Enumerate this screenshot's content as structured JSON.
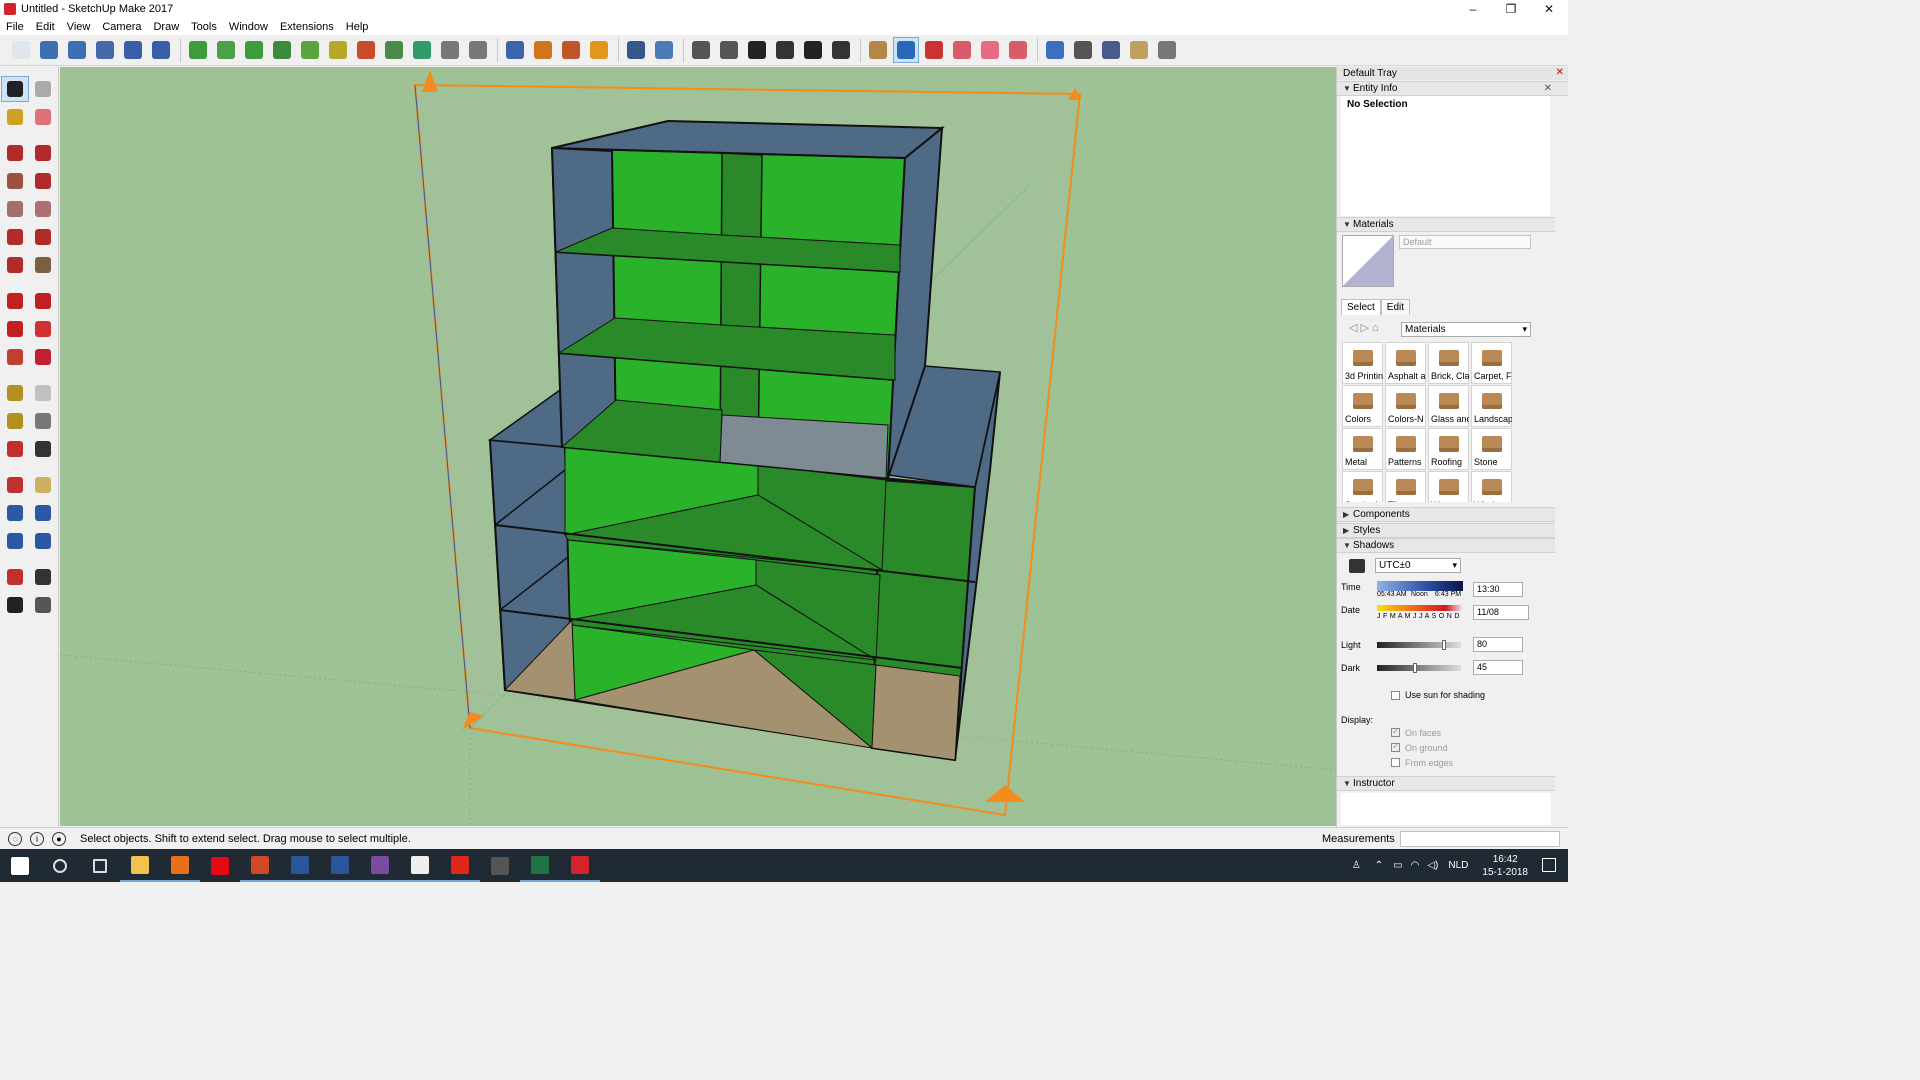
{
  "window": {
    "title": "Untitled - SketchUp Make 2017",
    "minimize": "–",
    "maximize": "❐",
    "close": "✕"
  },
  "menu": [
    "File",
    "Edit",
    "View",
    "Camera",
    "Draw",
    "Tools",
    "Window",
    "Extensions",
    "Help"
  ],
  "toolbar_icons": [
    "new-file-icon",
    "open-icon",
    "save-icon",
    "model-info-icon",
    "export-ifc-icon",
    "import-ifc-icon",
    "sep",
    "add-location-icon",
    "add-3d-text-icon",
    "photo-textures-icon",
    "preview-google-earth-icon",
    "get-models-icon",
    "add-light-icon",
    "sandbox-icon",
    "smoove-icon",
    "stamp-icon",
    "drape-icon",
    "flip-edge-icon",
    "sep",
    "zoom-icon",
    "filter-icon",
    "paint-tag-icon",
    "warning-icon",
    "sep",
    "cube-icon",
    "help-icon",
    "sep",
    "iso-view-icon",
    "top-view-icon",
    "front-view-icon",
    "right-view-icon",
    "back-view-icon",
    "left-view-icon",
    "sep",
    "xray-icon",
    "back-edges-icon",
    "wireframe-icon",
    "hidden-line-icon",
    "shaded-icon",
    "shaded-textures-icon",
    "sep",
    "monochrome-icon",
    "section-plane-icon",
    "section-cut-icon",
    "section-fill-icon",
    "calendar-icon"
  ],
  "active_toolbar_icon": "back-edges-icon",
  "palette_icons": [
    "select-icon",
    "component-icon",
    "paint-bucket-icon",
    "eraser-icon",
    "gap",
    "line-icon",
    "freehand-icon",
    "rectangle-icon",
    "rotated-rectangle-icon",
    "circle-icon",
    "polygon-icon",
    "arc-icon",
    "two-point-arc-icon",
    "three-point-arc-icon",
    "pie-icon",
    "gap",
    "move-icon",
    "push-pull-icon",
    "rotate-icon",
    "follow-me-icon",
    "scale-icon",
    "offset-icon",
    "gap",
    "tape-measure-icon",
    "dimension-icon",
    "protractor-icon",
    "text-icon",
    "axes-icon",
    "3d-text-icon",
    "gap",
    "orbit-icon",
    "pan-icon",
    "zoom-tool-icon",
    "zoom-window-icon",
    "zoom-extents-icon",
    "previous-view-icon",
    "gap",
    "position-camera-icon",
    "look-around-icon",
    "walk-icon",
    "section-icon"
  ],
  "tray": {
    "title": "Default Tray",
    "entity_info": {
      "header": "Entity Info",
      "selection": "No Selection"
    },
    "materials": {
      "header": "Materials",
      "name_placeholder": "Default",
      "tabs": [
        "Select",
        "Edit"
      ],
      "library": "Materials",
      "folders": [
        "3d Printin",
        "Asphalt a",
        "Brick, Cla",
        "Carpet, F",
        "Colors",
        "Colors-N",
        "Glass anc",
        "Landscap",
        "Metal",
        "Patterns",
        "Roofing",
        "Stone",
        "Synthetic",
        "Tile",
        "Water",
        "Window a"
      ]
    },
    "components": "Components",
    "styles": "Styles",
    "shadows": {
      "header": "Shadows",
      "timezone": "UTC±0",
      "time_label": "Time",
      "time_marks": [
        "05:43 AM",
        "Noon",
        "6:43 PM"
      ],
      "time_value": "13:30",
      "date_label": "Date",
      "months": "J F M A M J J A S O N D",
      "date_value": "11/08",
      "light_label": "Light",
      "light_value": "80",
      "light_level": 0.8,
      "dark_label": "Dark",
      "dark_value": "45",
      "dark_level": 0.45,
      "use_sun": "Use sun for shading",
      "display_label": "Display:",
      "on_faces": "On faces",
      "on_ground": "On ground",
      "from_edges": "From edges"
    },
    "instructor": "Instructor"
  },
  "status": {
    "text": "Select objects. Shift to extend select. Drag mouse to select multiple.",
    "measurements_label": "Measurements"
  },
  "taskbar": {
    "apps": [
      "start-icon",
      "search-icon",
      "task-view-icon",
      "file-explorer-icon",
      "firefox-icon",
      "netflix-icon",
      "powerpoint-icon",
      "word-2-icon",
      "word-icon",
      "winrar-icon",
      "photos-icon",
      "acrobat-icon",
      "calculator-icon",
      "excel-icon",
      "sketchup-icon"
    ],
    "language": "NLD",
    "time": "16:42",
    "date": "15-1-2018"
  },
  "colors": {
    "viewport_bg": "#9fc196",
    "green_face": "#2ab32a",
    "dark_green_face": "#2a8a2a",
    "blue_face": "#4f6a84",
    "tan_face": "#a4916f",
    "section_plane": "#f28c1c"
  }
}
